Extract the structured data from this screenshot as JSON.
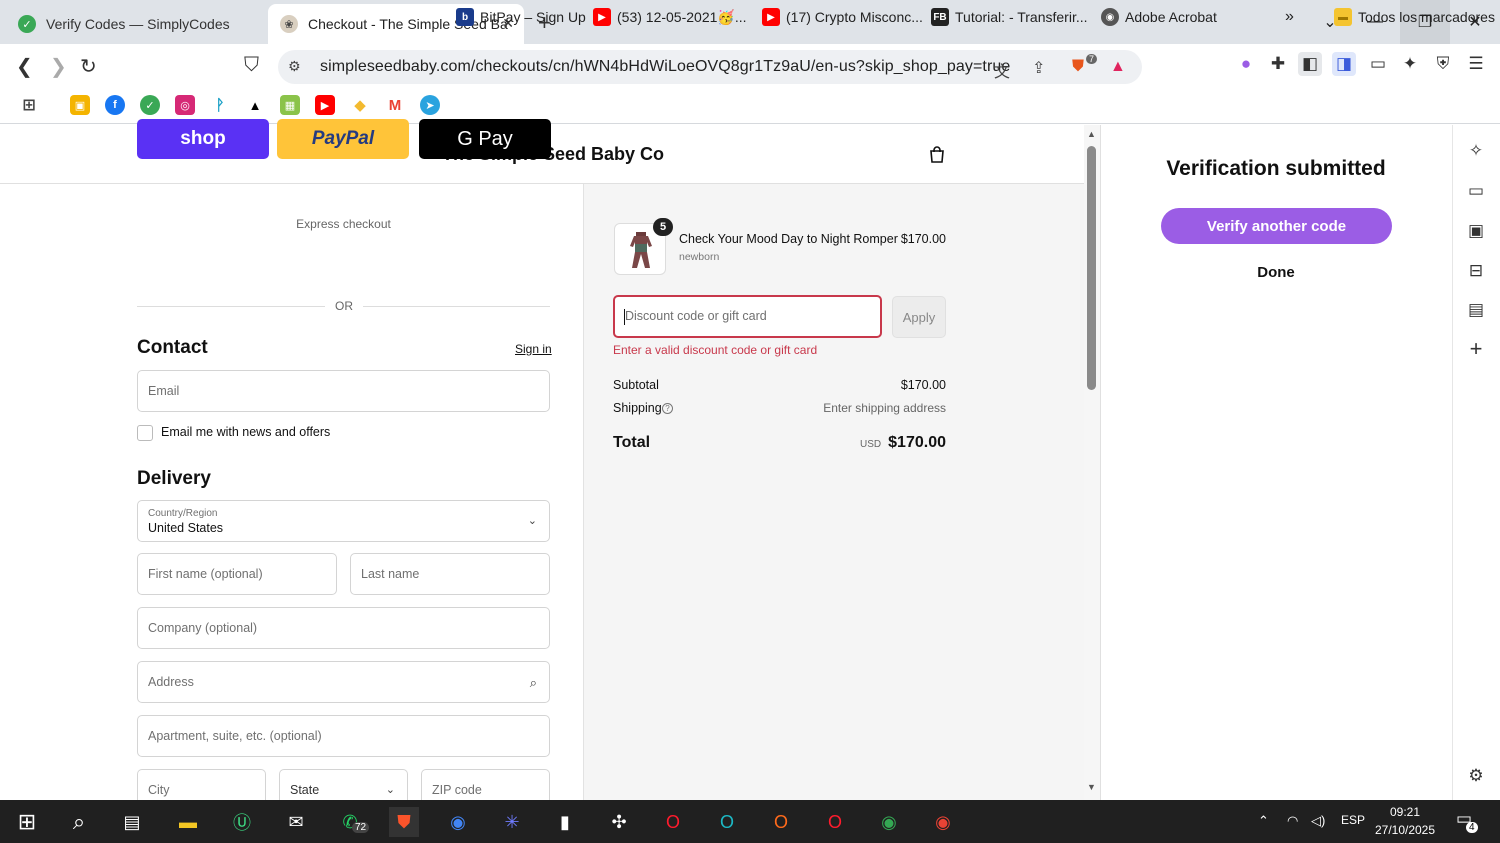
{
  "browser": {
    "tabs": [
      {
        "title": "Verify Codes — SimplyCodes",
        "active": false
      },
      {
        "title": "Checkout - The Simple Seed Ba",
        "active": true
      }
    ],
    "url": "simpleseedbaby.com/checkouts/cn/hWN4bHdWiLoeOVQ8gr1Tz9aU/en-us?skip_shop_pay=true",
    "bookmarks": [
      {
        "label": "BitPay – Sign Up"
      },
      {
        "label": "(53) 12-05-2021🥳..."
      },
      {
        "label": "(17) Crypto Misconc..."
      },
      {
        "label": "Tutorial: - Transferir..."
      },
      {
        "label": "Adobe Acrobat"
      },
      {
        "label": "Todos los marcadores"
      }
    ],
    "brave_badge": "7"
  },
  "store": {
    "name": "The Simple Seed Baby Co"
  },
  "checkout": {
    "express_label": "Express checkout",
    "express_buttons": [
      {
        "label": "shop",
        "color": "#5a31f4"
      },
      {
        "label": "PayPal",
        "color": "#ffc439"
      },
      {
        "label": "G Pay",
        "color": "#000000"
      }
    ],
    "or_label": "OR",
    "contact": {
      "heading": "Contact",
      "sign_in": "Sign in",
      "email_placeholder": "Email",
      "newsletter_label": "Email me with news and offers"
    },
    "delivery": {
      "heading": "Delivery",
      "country_label": "Country/Region",
      "country_value": "United States",
      "first_name_placeholder": "First name (optional)",
      "last_name_placeholder": "Last name",
      "company_placeholder": "Company (optional)",
      "address_placeholder": "Address",
      "apartment_placeholder": "Apartment, suite, etc. (optional)",
      "city_placeholder": "City",
      "state_placeholder": "State",
      "zip_placeholder": "ZIP code"
    }
  },
  "summary": {
    "item": {
      "name": "Check Your Mood Day to Night Romper",
      "variant": "newborn",
      "price": "$170.00",
      "quantity": "5"
    },
    "discount_placeholder": "Discount code or gift card",
    "apply_label": "Apply",
    "error": "Enter a valid discount code or gift card",
    "subtotal_label": "Subtotal",
    "subtotal_value": "$170.00",
    "shipping_label": "Shipping",
    "shipping_value": "Enter shipping address",
    "total_label": "Total",
    "currency": "USD",
    "total_value": "$170.00"
  },
  "sidepanel": {
    "title": "Verification submitted",
    "verify_button": "Verify another code",
    "done_button": "Done"
  },
  "taskbar": {
    "whatsapp_badge": "72",
    "language": "ESP",
    "time": "09:21",
    "date": "27/10/2025",
    "notifications": "4"
  }
}
